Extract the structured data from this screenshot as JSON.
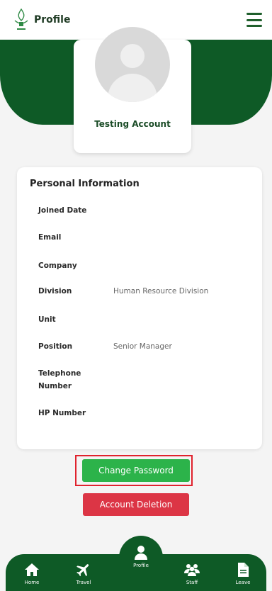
{
  "header": {
    "title": "Profile"
  },
  "profile": {
    "name": "Testing Account"
  },
  "personal_info": {
    "title": "Personal Information",
    "rows": [
      {
        "label": "Joined Date",
        "value": ""
      },
      {
        "label": "Email",
        "value": ""
      },
      {
        "label": "Company",
        "value": ""
      },
      {
        "label": "Division",
        "value": "Human Resource Division"
      },
      {
        "label": "Unit",
        "value": ""
      },
      {
        "label": "Position",
        "value": "Senior Manager"
      },
      {
        "label": "Telephone Number",
        "value": ""
      },
      {
        "label": "HP Number",
        "value": ""
      }
    ]
  },
  "actions": {
    "change_password": "Change Password",
    "account_deletion": "Account Deletion"
  },
  "nav": {
    "home": "Home",
    "travel": "Travel",
    "profile": "Profile",
    "staff": "Staff",
    "leave": "Leave"
  },
  "colors": {
    "brand_green": "#0e5a26",
    "button_green": "#2cb34a",
    "button_red": "#dc3545",
    "highlight_red": "#e0222d"
  }
}
